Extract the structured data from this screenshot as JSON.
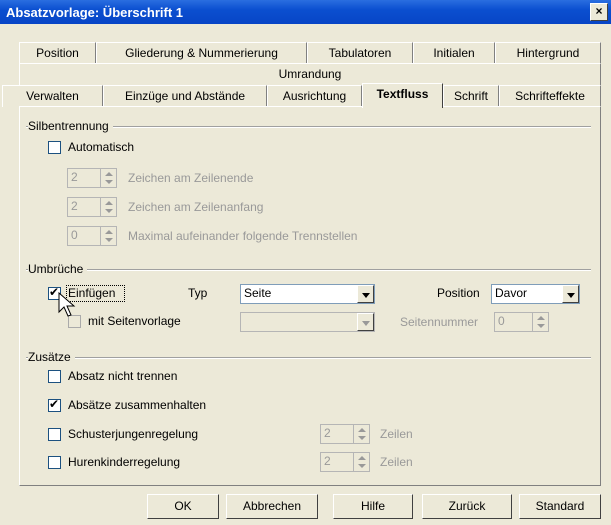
{
  "window": {
    "title": "Absatzvorlage: Überschrift 1",
    "close": "×"
  },
  "tabs": {
    "row1": [
      "Position",
      "Gliederung & Nummerierung",
      "Tabulatoren",
      "Initialen",
      "Hintergrund"
    ],
    "row2": [
      "Umrandung"
    ],
    "row3": [
      "Verwalten",
      "Einzüge und Abstände",
      "Ausrichtung",
      "Textfluss",
      "Schrift",
      "Schrifteffekte"
    ],
    "active": "Textfluss"
  },
  "silbentrennung": {
    "title": "Silbentrennung",
    "automatisch": {
      "label": "Automatisch",
      "checked": false
    },
    "zeilenende": {
      "value": "2",
      "label": "Zeichen am Zeilenende"
    },
    "zeilenanfang": {
      "value": "2",
      "label": "Zeichen am Zeilenanfang"
    },
    "maximal": {
      "value": "0",
      "label": "Maximal aufeinander folgende Trennstellen"
    }
  },
  "umbrueche": {
    "title": "Umbrüche",
    "einfuegen": {
      "label": "Einfügen",
      "checked": true
    },
    "typ_label": "Typ",
    "typ_value": "Seite",
    "position_label": "Position",
    "position_value": "Davor",
    "seitenvorlage": {
      "label": "mit Seitenvorlage",
      "checked": false
    },
    "seitenvorlage_value": "",
    "seitennummer_label": "Seitennummer",
    "seitennummer_value": "0"
  },
  "zusaetze": {
    "title": "Zusätze",
    "nicht_trennen": {
      "label": "Absatz nicht trennen",
      "checked": false
    },
    "zusammenhalten": {
      "label": "Absätze zusammenhalten",
      "checked": true
    },
    "schusterjungen": {
      "label": "Schusterjungenregelung",
      "checked": false,
      "value": "2",
      "unit": "Zeilen"
    },
    "hurenkinder": {
      "label": "Hurenkinderregelung",
      "checked": false,
      "value": "2",
      "unit": "Zeilen"
    }
  },
  "buttons": {
    "ok": "OK",
    "cancel": "Abbrechen",
    "help": "Hilfe",
    "back": "Zurück",
    "standard": "Standard"
  }
}
